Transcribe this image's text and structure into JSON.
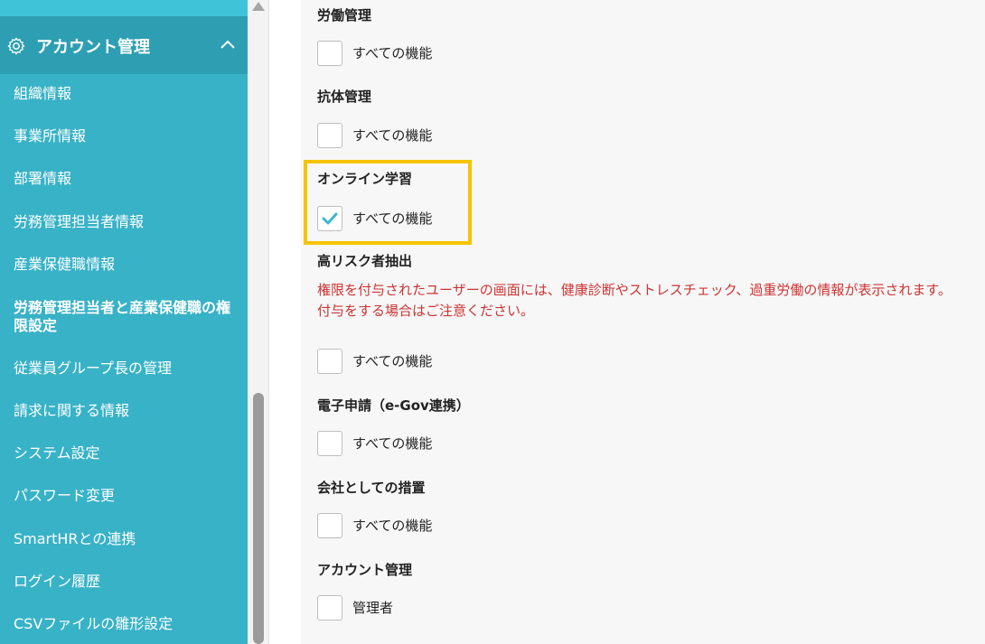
{
  "sidebar": {
    "header_title": "アカウント管理",
    "items": [
      {
        "label": "組織情報"
      },
      {
        "label": "事業所情報"
      },
      {
        "label": "部署情報"
      },
      {
        "label": "労務管理担当者情報"
      },
      {
        "label": "産業保健職情報"
      },
      {
        "label": "労務管理担当者と産業保健職の権限設定"
      },
      {
        "label": "従業員グループ長の管理"
      },
      {
        "label": "請求に関する情報"
      },
      {
        "label": "システム設定"
      },
      {
        "label": "パスワード変更"
      },
      {
        "label": "SmartHRとの連携"
      },
      {
        "label": "ログイン履歴"
      },
      {
        "label": "CSVファイルの雛形設定"
      }
    ]
  },
  "sections": [
    {
      "title": "労働管理",
      "option": "すべての機能",
      "checked": false
    },
    {
      "title": "抗体管理",
      "option": "すべての機能",
      "checked": false
    },
    {
      "title": "オンライン学習",
      "option": "すべての機能",
      "checked": true
    },
    {
      "title": "高リスク者抽出",
      "option": "すべての機能",
      "checked": false,
      "warning_line1": "権限を付与されたユーザーの画面には、健康診断やストレスチェック、過重労働の情報が表示されます。",
      "warning_line2": "付与をする場合はご注意ください。"
    },
    {
      "title": "電子申請（e-Gov連携）",
      "option": "すべての機能",
      "checked": false
    },
    {
      "title": "会社としての措置",
      "option": "すべての機能",
      "checked": false
    },
    {
      "title": "アカウント管理",
      "option": "管理者",
      "checked": false
    }
  ],
  "colors": {
    "sidebar": "#38b2c7",
    "check": "#3bb8cc",
    "warning": "#cc3333",
    "highlight": "#f5c400"
  }
}
